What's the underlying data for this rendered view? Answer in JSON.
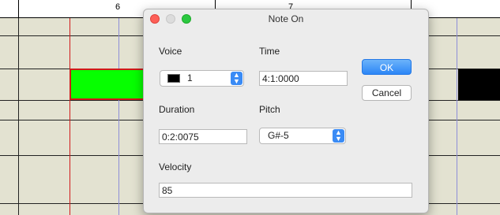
{
  "ruler": {
    "marker_a": "6",
    "marker_b": "7"
  },
  "dialog": {
    "title": "Note On",
    "voice": {
      "label": "Voice",
      "value": "1",
      "swatch_color": "#000000"
    },
    "time": {
      "label": "Time",
      "value": "4:1:0000"
    },
    "duration": {
      "label": "Duration",
      "value": "0:2:0075"
    },
    "pitch": {
      "label": "Pitch",
      "value": "G#-5"
    },
    "velocity": {
      "label": "Velocity",
      "value": "85"
    },
    "buttons": {
      "ok": "OK",
      "cancel": "Cancel"
    }
  },
  "colors": {
    "note_fill": "#06ff00",
    "note_border": "#d11a1a",
    "accent": "#3a8bf5",
    "roll_bg": "#e3e2d1"
  }
}
